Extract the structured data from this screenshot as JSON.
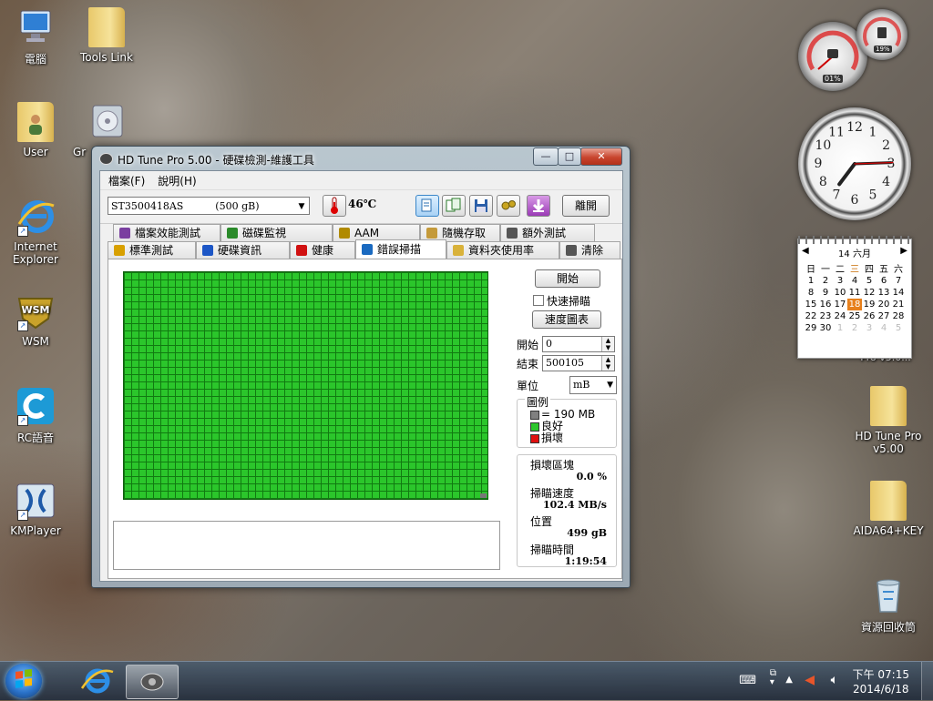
{
  "desktop": {
    "icons_left": [
      {
        "label": "電腦",
        "icon": "computer-icon"
      },
      {
        "label": "User",
        "icon": "user-folder-icon"
      },
      {
        "label": "Internet Explorer",
        "icon": "ie-icon"
      },
      {
        "label": "WSM",
        "icon": "wsm-icon"
      },
      {
        "label": "RC語音",
        "icon": "rc-voice-icon"
      },
      {
        "label": "KMPlayer",
        "icon": "kmplayer-icon"
      }
    ],
    "icons_col2": [
      {
        "label": "Tools Link",
        "icon": "folder-icon"
      },
      {
        "label": "Gr",
        "icon": "disc-icon"
      }
    ],
    "icons_right": [
      {
        "label": "HD Tune Pro v5.00",
        "icon": "folder-icon"
      },
      {
        "label": "AIDA64+KEY",
        "icon": "folder-icon"
      },
      {
        "label": "資源回收筒",
        "icon": "recycle-bin-icon"
      }
    ],
    "partial_label": "Pro v5.0..."
  },
  "gadgets": {
    "meter": {
      "cpu": "01%",
      "mem": "19%"
    },
    "clock": {
      "numbers": [
        "12",
        "1",
        "2",
        "3",
        "4",
        "5",
        "6",
        "7",
        "8",
        "9",
        "10",
        "11"
      ]
    },
    "calendar": {
      "header": "14 六月",
      "weekdays": [
        "日",
        "一",
        "二",
        "三",
        "四",
        "五",
        "六"
      ],
      "weeks": [
        [
          "1",
          "2",
          "3",
          "4",
          "5",
          "6",
          "7"
        ],
        [
          "8",
          "9",
          "10",
          "11",
          "12",
          "13",
          "14"
        ],
        [
          "15",
          "16",
          "17",
          "18",
          "19",
          "20",
          "21"
        ],
        [
          "22",
          "23",
          "24",
          "25",
          "26",
          "27",
          "28"
        ],
        [
          "29",
          "30",
          "1",
          "2",
          "3",
          "4",
          "5"
        ]
      ],
      "today": "18"
    }
  },
  "window": {
    "title": "HD Tune Pro  5.00 - 硬碟檢測-維護工具",
    "menu": [
      "檔案(F)",
      "說明(H)"
    ],
    "drive": "ST3500418AS          (500 gB)",
    "temperature": "46℃",
    "exit_label": "離開",
    "tabs_row1": [
      {
        "label": "檔案效能測試",
        "icon": "file-benchmark-icon",
        "color": "#7a3fa0"
      },
      {
        "label": "磁碟監視",
        "icon": "disk-monitor-icon",
        "color": "#2a8a2a"
      },
      {
        "label": "AAM",
        "icon": "speaker-icon",
        "color": "#b08a00"
      },
      {
        "label": "隨機存取",
        "icon": "random-access-icon",
        "color": "#c49a3a"
      },
      {
        "label": "額外測試",
        "icon": "extra-tests-icon",
        "color": "#555555"
      }
    ],
    "tabs_row2": [
      {
        "label": "標準測試",
        "icon": "benchmark-icon",
        "color": "#d8a000"
      },
      {
        "label": "硬碟資訊",
        "icon": "info-icon",
        "color": "#1c56c6"
      },
      {
        "label": "健康",
        "icon": "health-cross-icon",
        "color": "#d01010"
      },
      {
        "label": "錯誤掃描",
        "icon": "error-scan-icon",
        "color": "#1a6ac0"
      },
      {
        "label": "資料夾使用率",
        "icon": "folder-usage-icon",
        "color": "#d9b23a"
      },
      {
        "label": "清除",
        "icon": "erase-icon",
        "color": "#555555"
      }
    ],
    "selected_tab": "錯誤掃描",
    "error_scan": {
      "start_button": "開始",
      "quick_scan_label": "快速掃瞄",
      "quick_scan_checked": false,
      "speed_map_button": "速度圖表",
      "start_label": "開始",
      "start_value": "0",
      "end_label": "結束",
      "end_value": "500105",
      "unit_label": "單位",
      "unit_value": "mB",
      "legend_title": "圖例",
      "legend": [
        {
          "text": "= 190 MB",
          "color": "#808080"
        },
        {
          "text": "良好",
          "color": "#2bc62b"
        },
        {
          "text": "損壞",
          "color": "#e01010"
        }
      ],
      "stats": [
        {
          "label": "損壞區塊",
          "value": "0.0 %"
        },
        {
          "label": "掃瞄速度",
          "value": "102.4 MB/s"
        },
        {
          "label": "位置",
          "value": "499 gB"
        },
        {
          "label": "掃瞄時間",
          "value": "1:19:54"
        }
      ],
      "colors": {
        "good": "#2bc62b",
        "grid_line": "#117a11",
        "last_block": "#777777"
      }
    }
  },
  "taskbar": {
    "time": "下午 07:15",
    "date": "2014/6/18"
  }
}
